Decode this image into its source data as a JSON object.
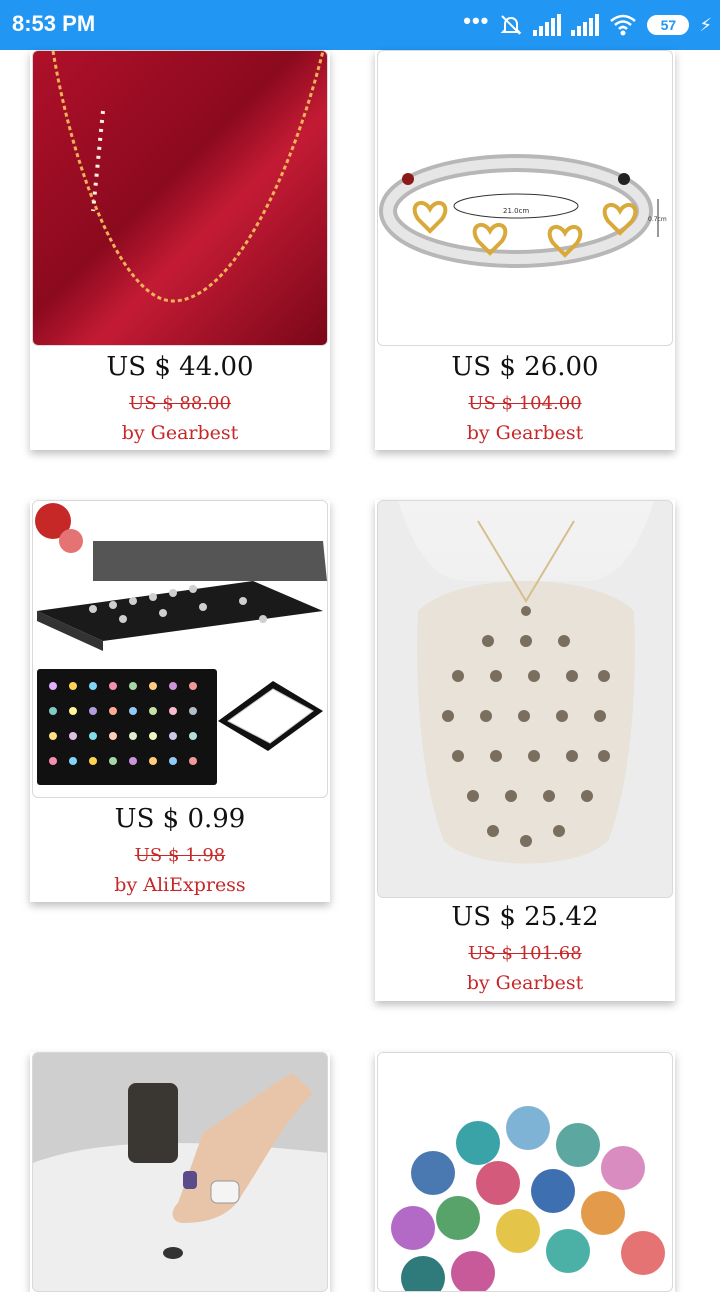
{
  "status_bar": {
    "time": "8:53 PM",
    "battery": "57"
  },
  "products": [
    {
      "price": "US $ 44.00",
      "old_price": "US $ 88.00",
      "seller": "by Gearbest"
    },
    {
      "price": "US $ 26.00",
      "old_price": "US $ 104.00",
      "seller": "by Gearbest",
      "dimensions": [
        "21.0cm",
        "0.7cm"
      ]
    },
    {
      "price": "US $ 0.99",
      "old_price": "US $ 1.98",
      "seller": "by AliExpress"
    },
    {
      "price": "US $ 25.42",
      "old_price": "US $ 101.68",
      "seller": "by Gearbest"
    },
    {
      "price": "",
      "old_price": "",
      "seller": ""
    },
    {
      "price": "",
      "old_price": "",
      "seller": ""
    }
  ],
  "colors": {
    "status_bar": "#2196f3",
    "price_red": "#c62828"
  }
}
